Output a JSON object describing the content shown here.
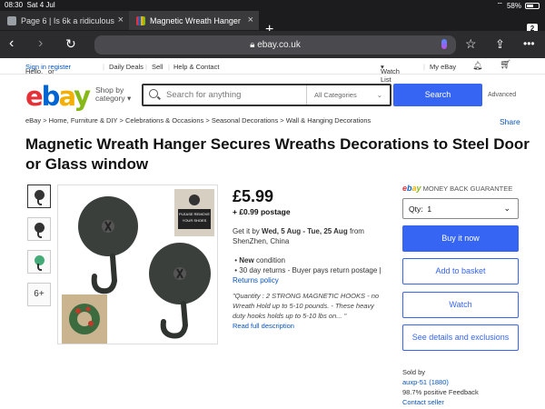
{
  "status": {
    "time": "08:30",
    "date": "Sat 4 Jul",
    "battery": "58%",
    "battery_level": 0.58
  },
  "tabs": [
    {
      "title": "Page 6 | Is 6k a ridiculous"
    },
    {
      "title": "Magnetic Wreath Hanger"
    }
  ],
  "tab_count": "2",
  "url": "ebay.co.uk",
  "topnav": {
    "hello": "Hello.",
    "signin": "Sign in",
    "or": "or",
    "register": "register",
    "daily_deals": "Daily Deals",
    "sell": "Sell",
    "help": "Help & Contact",
    "watch_list": "Watch List",
    "my_ebay": "My eBay"
  },
  "header": {
    "shop_by": "Shop by",
    "category": "category",
    "search_placeholder": "Search for anything",
    "all_categories": "All Categories",
    "search_button": "Search",
    "advanced": "Advanced"
  },
  "breadcrumb": [
    "eBay",
    "Home, Furniture & DIY",
    "Celebrations & Occasions",
    "Seasonal Decorations",
    "Wall & Hanging Decorations"
  ],
  "share": "Share",
  "title": "Magnetic Wreath Hanger Secures Wreaths Decorations to Steel Door or Glass window",
  "thumbs_more": "6+",
  "product_image": {
    "sign_line1": "PLEASE REMOVE",
    "sign_line2": "YOUR SHOES"
  },
  "price": "£5.99",
  "postage": "+ £0.99 postage",
  "delivery": {
    "prefix": "Get it by",
    "dates": "Wed, 5 Aug - Tue, 25 Aug",
    "from": "from",
    "origin": "ShenZhen, China"
  },
  "condition": {
    "label": "New",
    "suffix": "condition"
  },
  "returns": {
    "text": "30 day returns - Buyer pays return postage",
    "link": "Returns policy"
  },
  "quote": "\"Quantity : 2 STRONG MAGNETIC HOOKS - no Wreath Hold up to 5-10 pounds. - These heavy duty hooks holds up to 5-10 lbs on... \"",
  "read_more": "Read full description",
  "guarantee": "MONEY BACK GUARANTEE",
  "guarantee_logo": "ebay",
  "qty_label": "Qty:",
  "qty_value": "1",
  "buttons": {
    "buy": "Buy it now",
    "basket": "Add to basket",
    "watch": "Watch",
    "shipping": "See details and exclusions"
  },
  "seller": {
    "label": "Sold by",
    "name": "auxp-51",
    "score": "(1880)",
    "feedback": "98.7% positive Feedback",
    "contact": "Contact seller"
  }
}
